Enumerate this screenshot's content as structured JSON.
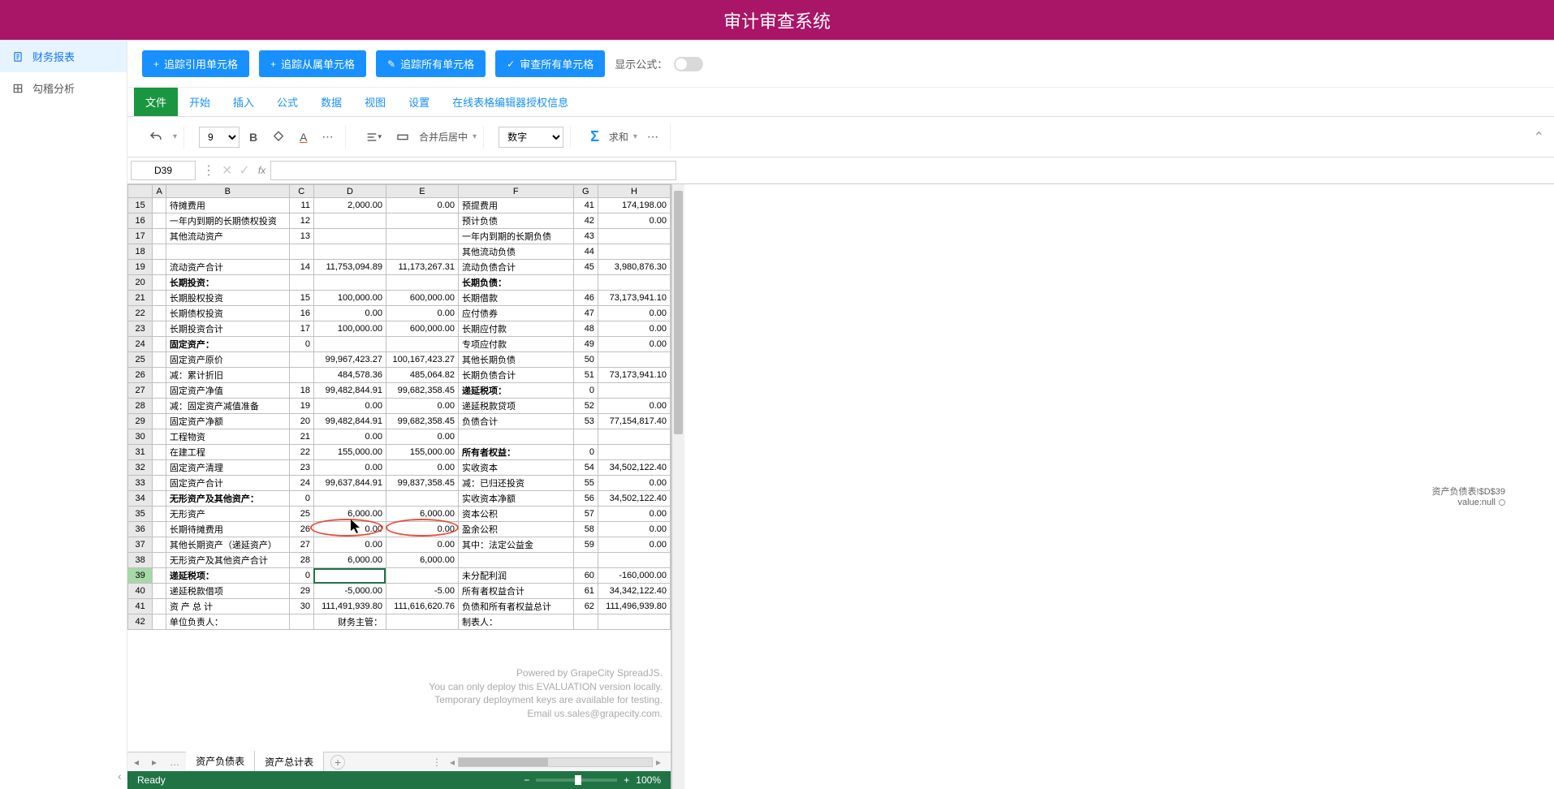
{
  "header": {
    "title": "审计审查系统"
  },
  "sidebar": {
    "items": [
      {
        "label": "财务报表",
        "icon": "document-icon"
      },
      {
        "label": "勾稽分析",
        "icon": "grid-icon"
      }
    ]
  },
  "toolbar": {
    "trace_ref": "追踪引用单元格",
    "trace_dep": "追踪从属单元格",
    "trace_all": "追踪所有单元格",
    "audit_all": "审查所有单元格",
    "show_formula": "显示公式："
  },
  "ribbon_tabs": [
    "文件",
    "开始",
    "插入",
    "公式",
    "数据",
    "视图",
    "设置",
    "在线表格编辑器授权信息"
  ],
  "ribbon": {
    "font_size": "9",
    "align_label": "合并后居中",
    "number_format": "数字",
    "sum_label": "求和"
  },
  "formula_bar": {
    "cell_ref": "D39",
    "formula": ""
  },
  "columns": [
    "A",
    "B",
    "C",
    "D",
    "E",
    "F",
    "G",
    "H"
  ],
  "rows": [
    {
      "n": "15",
      "B": "    待摊费用",
      "C": "11",
      "D": "2,000.00",
      "E": "0.00",
      "F": "预提费用",
      "G": "41",
      "H": "174,198.00"
    },
    {
      "n": "16",
      "B": "一年内到期的长期债权投资",
      "C": "12",
      "D": "",
      "E": "",
      "F": "预计负债",
      "G": "42",
      "H": "0.00"
    },
    {
      "n": "17",
      "B": "其他流动资产",
      "C": "13",
      "D": "",
      "E": "",
      "F": "一年内到期的长期负债",
      "G": "43",
      "H": ""
    },
    {
      "n": "18",
      "B": "",
      "C": "",
      "D": "",
      "E": "",
      "F": "其他流动负债",
      "G": "44",
      "H": ""
    },
    {
      "n": "19",
      "B": "  流动资产合计",
      "C": "14",
      "D": "11,753,094.89",
      "E": "11,173,267.31",
      "F": "流动负债合计",
      "G": "45",
      "H": "3,980,876.30"
    },
    {
      "n": "20",
      "B": "长期投资：",
      "C": "",
      "D": "",
      "E": "",
      "F": "长期负债：",
      "G": "",
      "H": "",
      "bold": true,
      "boldF": true
    },
    {
      "n": "21",
      "B": "  长期股权投资",
      "C": "15",
      "D": "100,000.00",
      "E": "600,000.00",
      "F": "长期借款",
      "G": "46",
      "H": "73,173,941.10"
    },
    {
      "n": "22",
      "B": "  长期债权投资",
      "C": "16",
      "D": "0.00",
      "E": "0.00",
      "F": "应付债券",
      "G": "47",
      "H": "0.00"
    },
    {
      "n": "23",
      "B": "  长期投资合计",
      "C": "17",
      "D": "100,000.00",
      "E": "600,000.00",
      "F": "长期应付款",
      "G": "48",
      "H": "0.00"
    },
    {
      "n": "24",
      "B": "固定资产：",
      "C": "0",
      "D": "",
      "E": "",
      "F": "专项应付款",
      "G": "49",
      "H": "0.00",
      "bold": true
    },
    {
      "n": "25",
      "B": "固定资产原价",
      "C": "",
      "D": "99,967,423.27",
      "E": "100,167,423.27",
      "F": "其他长期负债",
      "G": "50",
      "H": ""
    },
    {
      "n": "26",
      "B": "  减：累计折旧",
      "C": "",
      "D": "484,578.36",
      "E": "485,064.82",
      "F": "长期负债合计",
      "G": "51",
      "H": "73,173,941.10"
    },
    {
      "n": "27",
      "B": "固定资产净值",
      "C": "18",
      "D": "99,482,844.91",
      "E": "99,682,358.45",
      "F": "递延税项：",
      "G": "0",
      "H": "",
      "boldF": true
    },
    {
      "n": "28",
      "B": "  减：固定资产减值准备",
      "C": "19",
      "D": "0.00",
      "E": "0.00",
      "F": "递延税款贷项",
      "G": "52",
      "H": "0.00"
    },
    {
      "n": "29",
      "B": "固定资产净额",
      "C": "20",
      "D": "99,482,844.91",
      "E": "99,682,358.45",
      "F": "负债合计",
      "G": "53",
      "H": "77,154,817.40"
    },
    {
      "n": "30",
      "B": "工程物资",
      "C": "21",
      "D": "0.00",
      "E": "0.00",
      "F": "",
      "G": "",
      "H": ""
    },
    {
      "n": "31",
      "B": "在建工程",
      "C": "22",
      "D": "155,000.00",
      "E": "155,000.00",
      "F": "所有者权益：",
      "G": "0",
      "H": "",
      "boldF": true
    },
    {
      "n": "32",
      "B": "固定资产清理",
      "C": "23",
      "D": "0.00",
      "E": "0.00",
      "F": "实收资本",
      "G": "54",
      "H": "34,502,122.40"
    },
    {
      "n": "33",
      "B": "固定资产合计",
      "C": "24",
      "D": "99,637,844.91",
      "E": "99,837,358.45",
      "F": "减：已归还投资",
      "G": "55",
      "H": "0.00"
    },
    {
      "n": "34",
      "B": "无形资产及其他资产：",
      "C": "0",
      "D": "",
      "E": "",
      "F": "实收资本净额",
      "G": "56",
      "H": "34,502,122.40",
      "bold": true
    },
    {
      "n": "35",
      "B": "  无形资产",
      "C": "25",
      "D": "6,000.00",
      "E": "6,000.00",
      "F": "资本公积",
      "G": "57",
      "H": "0.00"
    },
    {
      "n": "36",
      "B": "长期待摊费用",
      "C": "26",
      "D": "0.00",
      "E": "0.00",
      "F": "盈余公积",
      "G": "58",
      "H": "0.00"
    },
    {
      "n": "37",
      "B": "其他长期资产（递延资产）",
      "C": "27",
      "D": "0.00",
      "E": "0.00",
      "F": "其中：法定公益金",
      "G": "59",
      "H": "0.00"
    },
    {
      "n": "38",
      "B": "无形资产及其他资产合计",
      "C": "28",
      "D": "6,000.00",
      "E": "6,000.00",
      "F": "",
      "G": "",
      "H": ""
    },
    {
      "n": "39",
      "B": "递延税项：",
      "C": "0",
      "D": "",
      "E": "",
      "F": "未分配利润",
      "G": "60",
      "H": "-160,000.00",
      "bold": true,
      "selectedRow": true,
      "selectedCell": "D"
    },
    {
      "n": "40",
      "B": "递延税款借项",
      "C": "29",
      "D": "-5,000.00",
      "E": "-5.00",
      "F": "所有者权益合计",
      "G": "61",
      "H": "34,342,122.40",
      "circled": true
    },
    {
      "n": "41",
      "B": "资 产 总 计",
      "C": "30",
      "D": "111,491,939.80",
      "E": "111,616,620.76",
      "F": "负债和所有者权益总计",
      "G": "62",
      "H": "111,496,939.80"
    },
    {
      "n": "42",
      "B": "单位负责人：",
      "C": "",
      "D": "财务主管：",
      "E": "",
      "F": "制表人：",
      "G": "",
      "H": "",
      "noborder": true
    }
  ],
  "watermark": {
    "l1": "Powered by GrapeCity SpreadJS.",
    "l2": "You can only deploy this EVALUATION version locally.",
    "l3": "Temporary deployment keys are available for testing.",
    "l4": "Email us.sales@grapecity.com."
  },
  "sheet_tabs": {
    "active": "资产负债表",
    "other": "资产总计表"
  },
  "status": {
    "ready": "Ready",
    "zoom": "100%"
  },
  "node": {
    "line1": "资产负债表!$D$39",
    "line2": "value:null"
  }
}
